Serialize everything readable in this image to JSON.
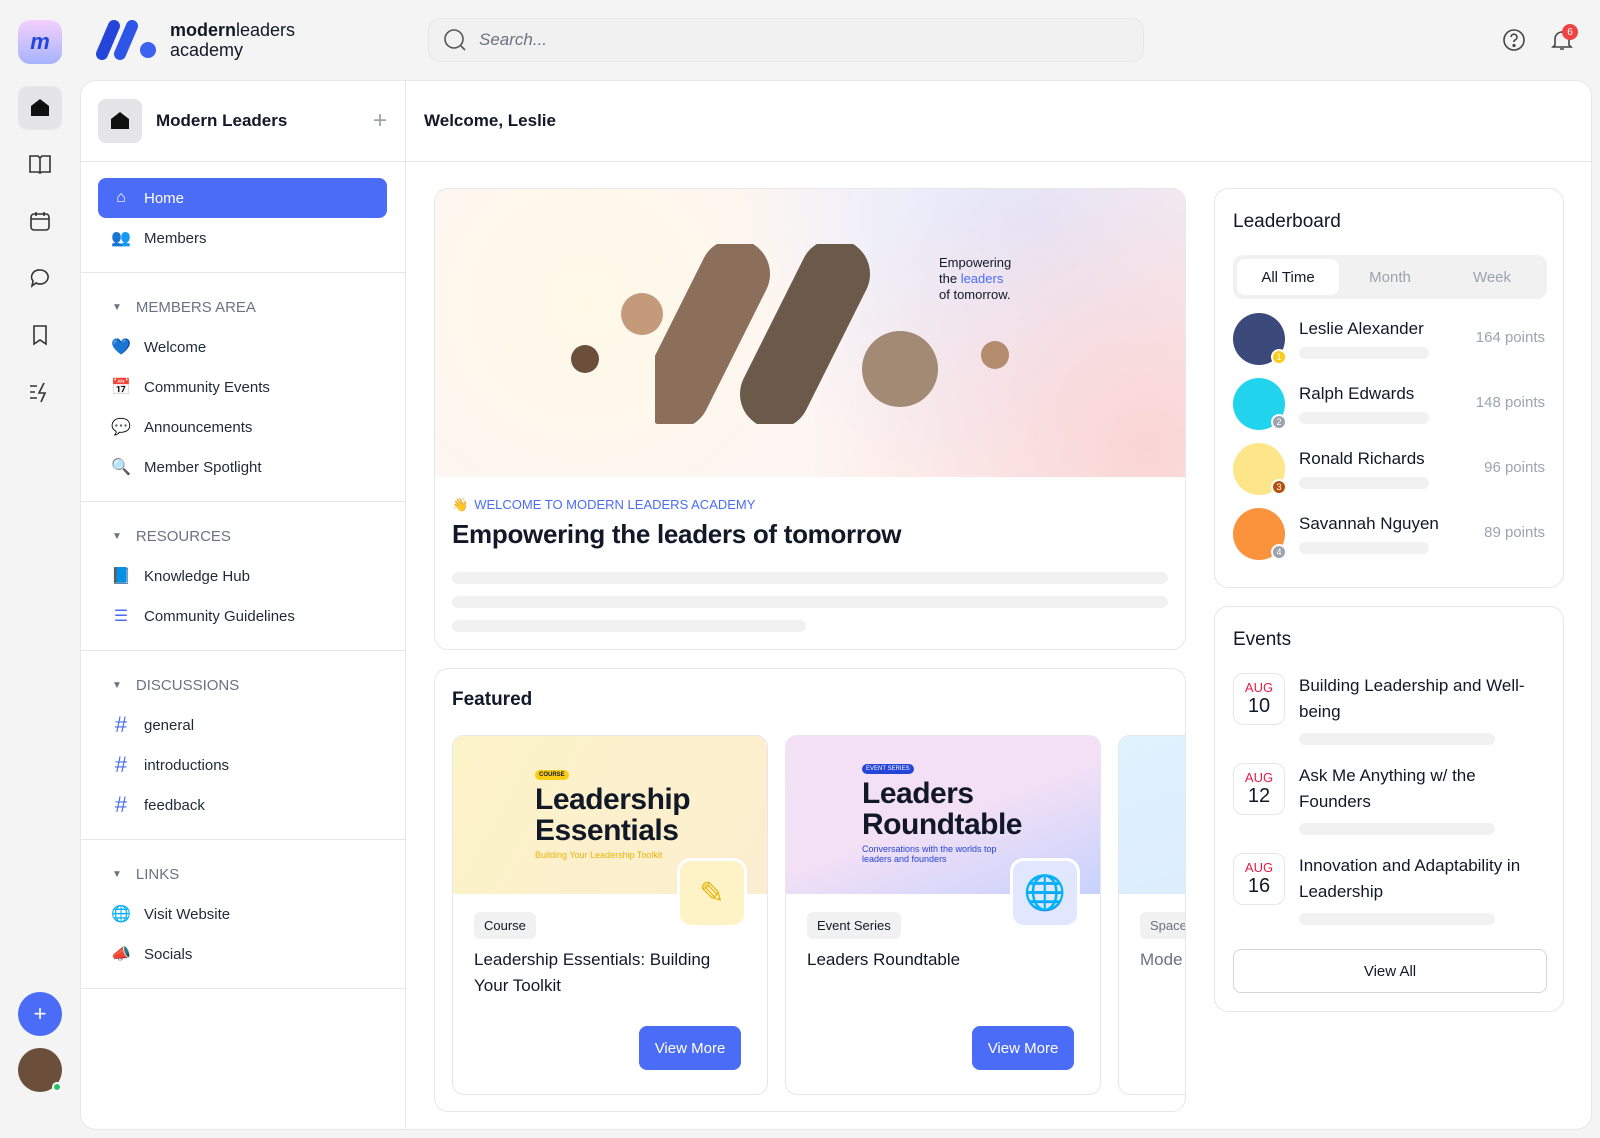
{
  "brand": {
    "line1_bold": "modern",
    "line1_rest": "leaders",
    "line2": "academy"
  },
  "search": {
    "placeholder": "Search..."
  },
  "header": {
    "notifications_count": "6"
  },
  "sidebar": {
    "community": "Modern Leaders",
    "top_items": [
      {
        "label": "Home",
        "icon": "home-icon"
      },
      {
        "label": "Members",
        "icon": "members-icon"
      }
    ],
    "sections": [
      {
        "title": "MEMBERS AREA",
        "items": [
          {
            "label": "Welcome",
            "icon": "heart-icon"
          },
          {
            "label": "Community Events",
            "icon": "calendar-icon"
          },
          {
            "label": "Announcements",
            "icon": "chat-icon"
          },
          {
            "label": "Member Spotlight",
            "icon": "spotlight-icon"
          }
        ]
      },
      {
        "title": "RESOURCES",
        "items": [
          {
            "label": "Knowledge Hub",
            "icon": "book-icon"
          },
          {
            "label": "Community Guidelines",
            "icon": "list-icon"
          }
        ]
      },
      {
        "title": "DISCUSSIONS",
        "items": [
          {
            "label": "general",
            "icon": "hash-icon"
          },
          {
            "label": "introductions",
            "icon": "hash-icon"
          },
          {
            "label": "feedback",
            "icon": "hash-icon"
          }
        ]
      },
      {
        "title": "LINKS",
        "items": [
          {
            "label": "Visit Website",
            "icon": "globe-icon"
          },
          {
            "label": "Socials",
            "icon": "megaphone-icon"
          }
        ]
      }
    ]
  },
  "main": {
    "welcome": "Welcome, Leslie",
    "hero": {
      "tagline_1": "Empowering",
      "tagline_2a": "the ",
      "tagline_2b": "leaders",
      "tagline_3": "of tomorrow.",
      "eyebrow": "WELCOME  TO MODERN LEADERS ACADEMY",
      "title": "Empowering the leaders of tomorrow"
    },
    "featured": {
      "title": "Featured",
      "cards": [
        {
          "banner_tag": "COURSE",
          "banner_title_1": "Leadership",
          "banner_title_2": "Essentials",
          "banner_sub": "Building Your Leadership Toolkit",
          "badge": "Course",
          "title": "Leadership Essentials: Building Your Toolkit",
          "button": "View More"
        },
        {
          "banner_tag": "EVENT SERIES",
          "banner_title_1": "Leaders",
          "banner_title_2": "Roundtable",
          "banner_sub": "Conversations with the worlds top leaders and founders",
          "badge": "Event Series",
          "title": "Leaders Roundtable",
          "button": "View More"
        },
        {
          "badge": "Space",
          "title": "Mode"
        }
      ]
    }
  },
  "leaderboard": {
    "title": "Leaderboard",
    "tabs": [
      "All Time",
      "Month",
      "Week"
    ],
    "active_tab": "All Time",
    "rows": [
      {
        "name": "Leslie Alexander",
        "points": "164 points",
        "rank": "1",
        "rank_color": "#facc15",
        "avatar_color": "#3b4a7a"
      },
      {
        "name": "Ralph Edwards",
        "points": "148 points",
        "rank": "2",
        "rank_color": "#9ca3af",
        "avatar_color": "#22d3ee"
      },
      {
        "name": "Ronald Richards",
        "points": "96 points",
        "rank": "3",
        "rank_color": "#b45309",
        "avatar_color": "#fde68a"
      },
      {
        "name": "Savannah Nguyen",
        "points": "89 points",
        "rank": "4",
        "rank_color": "#9ca3af",
        "avatar_color": "#fb923c"
      }
    ]
  },
  "events": {
    "title": "Events",
    "view_all": "View All",
    "items": [
      {
        "month": "AUG",
        "day": "10",
        "title": "Building Leadership and Well-being"
      },
      {
        "month": "AUG",
        "day": "12",
        "title": "Ask Me Anything w/ the Founders"
      },
      {
        "month": "AUG",
        "day": "16",
        "title": "Innovation and Adaptability in Leadership"
      }
    ]
  },
  "colors": {
    "accent": "#4a6cf7",
    "event_month": "#e11d48"
  }
}
